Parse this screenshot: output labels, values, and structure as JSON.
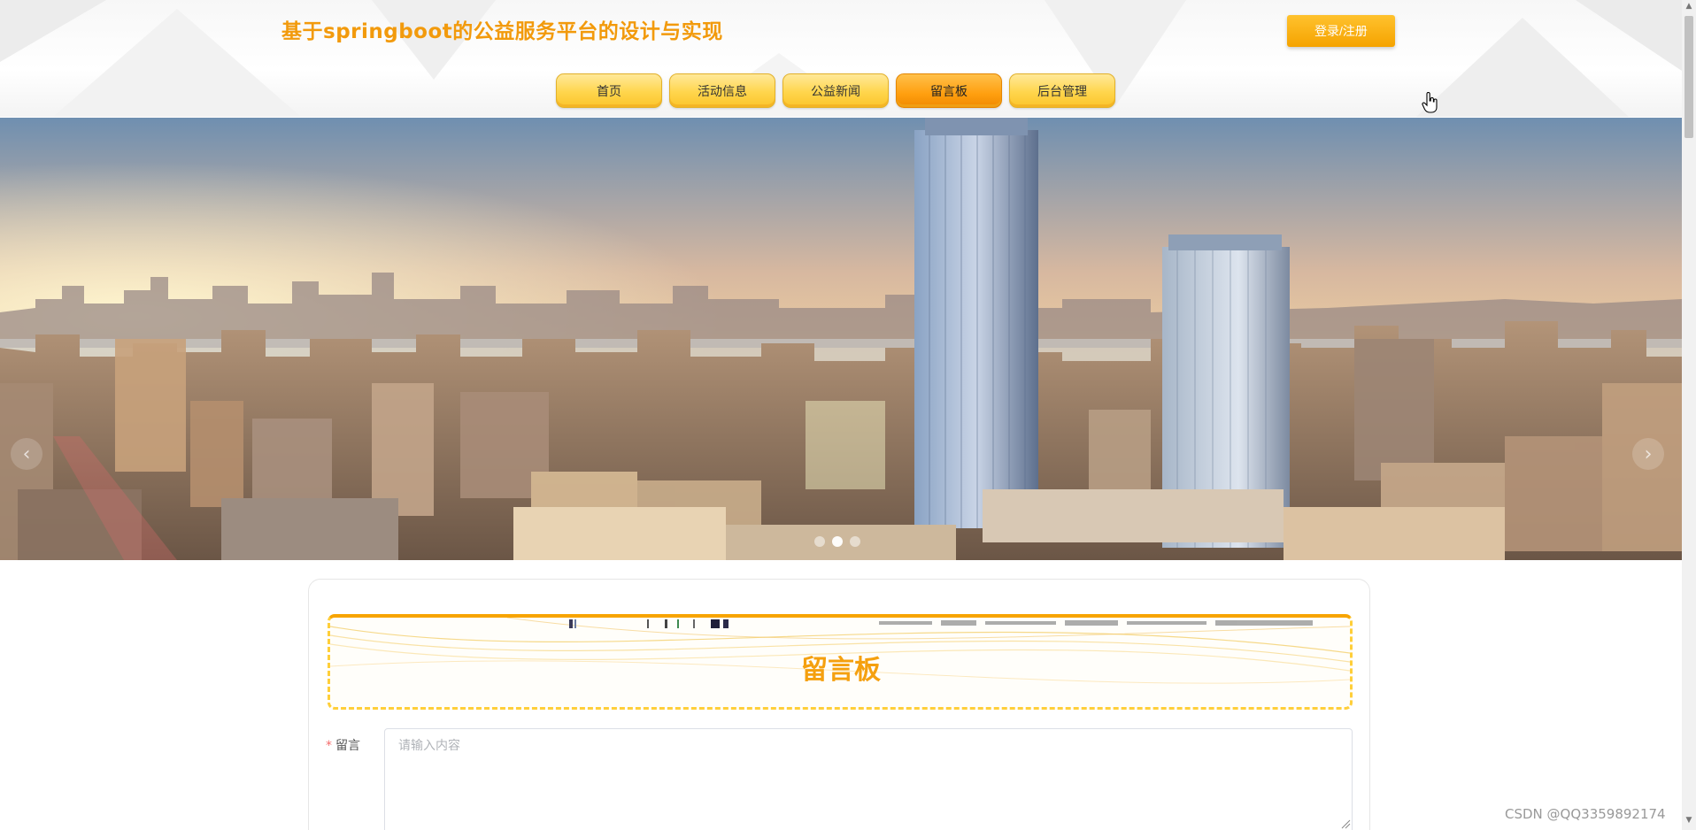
{
  "header": {
    "site_title": "基于springboot的公益服务平台的设计与实现",
    "login_label": "登录/注册"
  },
  "nav": {
    "items": [
      "首页",
      "活动信息",
      "公益新闻",
      "留言板",
      "后台管理"
    ],
    "active": "留言板"
  },
  "carousel": {
    "slide_count": 3,
    "active_slide": 2,
    "prev_icon": "chevron-left-icon",
    "next_icon": "chevron-right-icon"
  },
  "board": {
    "title": "留言板"
  },
  "form": {
    "message_label": "留言",
    "required_mark": "*",
    "message_placeholder": "请输入内容",
    "message_value": ""
  },
  "watermark": "CSDN @QQ3359892174",
  "colors": {
    "accent": "#f29a0c",
    "nav_yellow": "#ffd54c",
    "nav_active": "#ff9f0f",
    "login_button": "#f5a300",
    "required": "#f56c6c"
  }
}
